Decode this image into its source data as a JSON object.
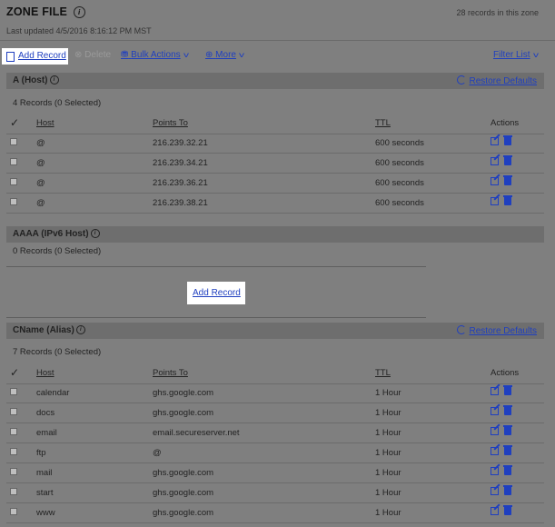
{
  "header": {
    "title": "ZONE FILE",
    "record_count": "28 records in this zone",
    "last_updated": "Last updated 4/5/2016 8:16:12 PM MST"
  },
  "toolbar": {
    "add_record": "Add Record",
    "delete": "Delete",
    "bulk_actions": "Bulk Actions",
    "more": "More",
    "filter_list": "Filter List"
  },
  "columns_a": {
    "host": "Host",
    "points_to": "Points To",
    "ttl": "TTL",
    "actions": "Actions"
  },
  "a_section": {
    "title": "A (Host)",
    "restore": "Restore Defaults",
    "count": "4 Records (0 Selected)",
    "rows": [
      {
        "host": "@",
        "points_to": "216.239.32.21",
        "ttl": "600 seconds"
      },
      {
        "host": "@",
        "points_to": "216.239.34.21",
        "ttl": "600 seconds"
      },
      {
        "host": "@",
        "points_to": "216.239.36.21",
        "ttl": "600 seconds"
      },
      {
        "host": "@",
        "points_to": "216.239.38.21",
        "ttl": "600 seconds"
      }
    ]
  },
  "aaaa_section": {
    "title": "AAAA (IPv6 Host)",
    "count": "0 Records (0 Selected)",
    "add_record": "Add Record"
  },
  "cname_section": {
    "title": "CName (Alias)",
    "restore": "Restore Defaults",
    "count": "7 Records (0 Selected)",
    "rows": [
      {
        "host": "calendar",
        "points_to": "ghs.google.com",
        "ttl": "1 Hour"
      },
      {
        "host": "docs",
        "points_to": "ghs.google.com",
        "ttl": "1 Hour"
      },
      {
        "host": "email",
        "points_to": "email.secureserver.net",
        "ttl": "1 Hour"
      },
      {
        "host": "ftp",
        "points_to": "@",
        "ttl": "1 Hour"
      },
      {
        "host": "mail",
        "points_to": "ghs.google.com",
        "ttl": "1 Hour"
      },
      {
        "host": "start",
        "points_to": "ghs.google.com",
        "ttl": "1 Hour"
      },
      {
        "host": "www",
        "points_to": "ghs.google.com",
        "ttl": "1 Hour"
      }
    ]
  }
}
